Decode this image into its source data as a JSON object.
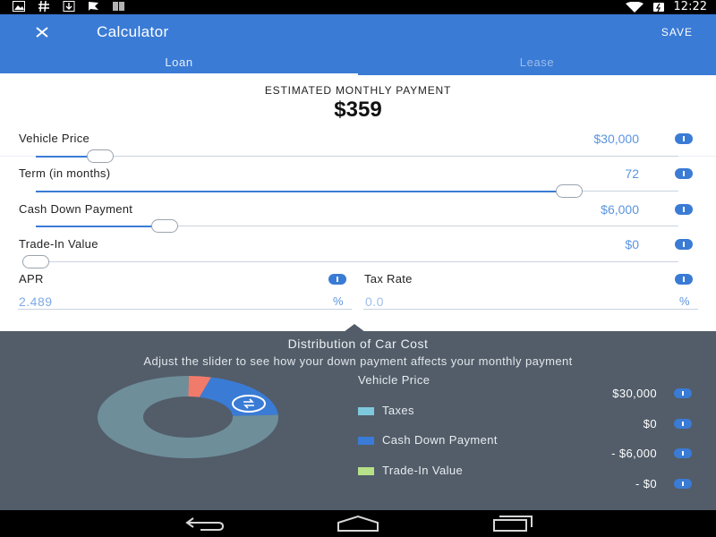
{
  "status_bar": {
    "icons": [
      "image-icon",
      "hash-icon",
      "download-icon",
      "flag-icon",
      "barcode-icon"
    ],
    "right_icons": [
      "wifi-icon",
      "battery-icon"
    ],
    "time": "12:22"
  },
  "app_bar": {
    "close_icon": "close-icon",
    "title": "Calculator",
    "save_label": "SAVE"
  },
  "tabs": [
    {
      "label": "Loan",
      "selected": true
    },
    {
      "label": "Lease",
      "selected": false
    }
  ],
  "payment": {
    "label": "ESTIMATED MONTHLY PAYMENT",
    "value": "$359"
  },
  "sliders": [
    {
      "label": "Vehicle Price",
      "value": "$30,000",
      "position": 0.1
    },
    {
      "label": "Term (in months)",
      "value": "72",
      "position": 0.83
    },
    {
      "label": "Cash Down Payment",
      "value": "$6,000",
      "position": 0.2
    },
    {
      "label": "Trade-In Value",
      "value": "$0",
      "position": 0.0
    }
  ],
  "apr": {
    "label": "APR",
    "value": "2.489",
    "suffix": "%"
  },
  "tax_rate": {
    "label": "Tax Rate",
    "placeholder": "0.0",
    "suffix": "%"
  },
  "distribution": {
    "title": "Distribution of Car Cost",
    "subtitle": "Adjust the slider to see how your down payment affects your monthly payment",
    "legend": [
      {
        "label": "Vehicle Price",
        "value": "$30,000",
        "color": null
      },
      {
        "label": "Taxes",
        "value": "$0",
        "color": "#7ec8dc"
      },
      {
        "label": "Cash Down Payment",
        "value": "- $6,000",
        "color": "#3a7bd5"
      },
      {
        "label": "Trade-In Value",
        "value": "- $0",
        "color": "#b6e08a"
      }
    ],
    "donut": {
      "segments": [
        {
          "name": "remaining",
          "fraction": 0.76,
          "color": "#6e8e9a"
        },
        {
          "name": "down-payment",
          "fraction": 0.2,
          "color": "#3a7bd5"
        },
        {
          "name": "trade-in-marker",
          "fraction": 0.04,
          "color": "#f07b6b"
        }
      ],
      "handle_icon": "swap-icon"
    }
  },
  "nav_bar": {
    "icons": [
      "back-icon",
      "home-icon",
      "recents-icon"
    ]
  }
}
